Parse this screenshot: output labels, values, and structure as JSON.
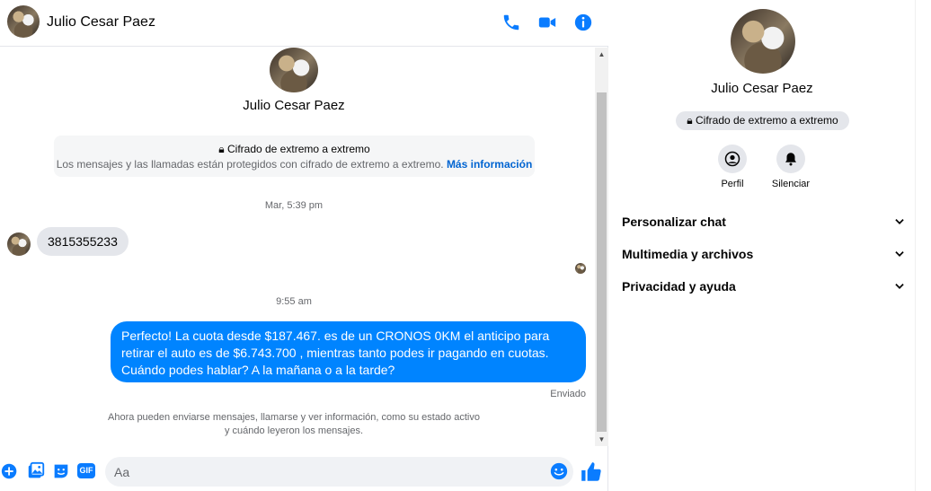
{
  "header": {
    "contact_name": "Julio Cesar Paez",
    "icons": [
      "phone-icon",
      "video-call-icon",
      "info-icon"
    ]
  },
  "conversation": {
    "contact_name": "Julio Cesar Paez",
    "e2e": {
      "title": "Cifrado de extremo a extremo",
      "description": "Los mensajes y las llamadas están protegidos con cifrado de extremo a extremo.",
      "link": "Más información"
    },
    "timestamp_1": "Mar, 5:39 pm",
    "incoming_message": "3815355233",
    "timestamp_2": "9:55 am",
    "outgoing_message": "Perfecto! La cuota desde $187.467. es de un CRONOS 0KM el anticipo para retirar el auto es de $6.743.700 , mientras tanto podes ir pagando en cuotas. Cuándo podes hablar? A la mañana o a la tarde?",
    "sent_status": "Enviado",
    "activity_note_line1": "Ahora pueden enviarse mensajes, llamarse y ver información, como su estado activo",
    "activity_note_line2": "y cuándo leyeron los mensajes."
  },
  "composer": {
    "placeholder": "Aa",
    "icons": [
      "plus-icon",
      "photo-icon",
      "sticker-icon",
      "gif-icon",
      "emoji-icon",
      "like-icon"
    ],
    "gif_label": "GIF"
  },
  "side_panel": {
    "contact_name": "Julio Cesar Paez",
    "e2e_badge": "Cifrado de extremo a extremo",
    "actions": [
      {
        "label": "Perfil",
        "icon": "profile-icon"
      },
      {
        "label": "Silenciar",
        "icon": "bell-icon"
      }
    ],
    "sections": [
      {
        "label": "Personalizar chat"
      },
      {
        "label": "Multimedia y archivos"
      },
      {
        "label": "Privacidad y ayuda"
      }
    ]
  },
  "colors": {
    "accent": "#0084ff",
    "icon_blue": "#0a7cff",
    "bubble_in": "#e4e6eb"
  }
}
